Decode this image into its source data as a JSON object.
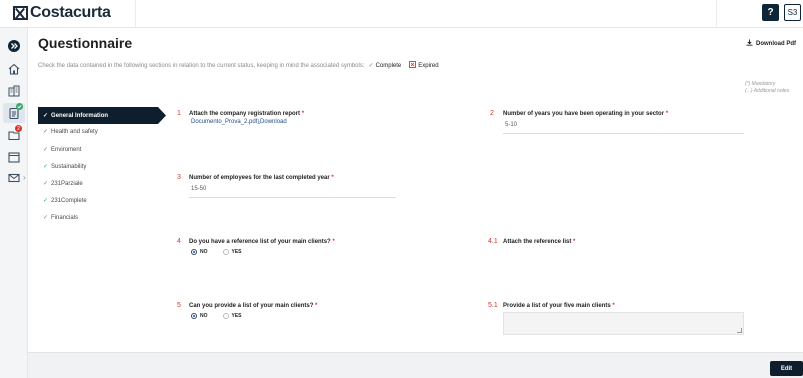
{
  "app": {
    "logo_text": "Costacurta"
  },
  "header": {
    "help_label": "?",
    "user_initials": "S3"
  },
  "rail": {
    "items": [
      {
        "icon": "expand-icon"
      },
      {
        "icon": "home-icon"
      },
      {
        "icon": "buildings-icon"
      },
      {
        "icon": "clipboard-icon",
        "badge_color": "#3aa86b"
      },
      {
        "icon": "folder-icon",
        "badge": "2",
        "badge_color": "#d9342b"
      },
      {
        "icon": "calendar-icon"
      },
      {
        "icon": "mail-icon"
      }
    ]
  },
  "page": {
    "title": "Questionnaire",
    "download_label": "Download Pdf",
    "subtitle": "Check the data contained in the following sections in relation to the current status, keeping in mind the associated symbols:",
    "status_complete": "Complete",
    "status_expired": "Expired",
    "legend_mandatory": "(*) Mandatory",
    "legend_notes": "(...) Additional notes"
  },
  "sections": [
    {
      "label": "General Information",
      "active": true
    },
    {
      "label": "Health and safety"
    },
    {
      "label": "Enviroment"
    },
    {
      "label": "Sustainability"
    },
    {
      "label": "231Parziale"
    },
    {
      "label": "231Complete"
    },
    {
      "label": "Financials"
    }
  ],
  "questions": {
    "q1": {
      "number": "1",
      "label": "Attach the company registration report",
      "file_name": "Documento_Prova_2.pdf",
      "download": "Download"
    },
    "q2": {
      "number": "2",
      "label": "Number of years you have been operating in your sector",
      "value": "5-10"
    },
    "q3": {
      "number": "3",
      "label": "Number of employees for the last completed year",
      "value": "15-50"
    },
    "q4": {
      "number": "4",
      "label": "Do you have a reference list of your main clients?",
      "option_no": "NO",
      "option_yes": "YES",
      "selected": "NO"
    },
    "q41": {
      "number": "4.1",
      "label": "Attach the reference list"
    },
    "q5": {
      "number": "5",
      "label": "Can you provide a list of your main clients?",
      "option_no": "NO",
      "option_yes": "YES",
      "selected": "NO"
    },
    "q51": {
      "number": "5.1",
      "label": "Provide a list of your five main clients",
      "value": ""
    }
  },
  "required_marker": "*",
  "footer": {
    "edit_label": "Edit"
  },
  "colors": {
    "accent": "#0e1e2c",
    "required": "#d9342b",
    "complete": "#3aa86b"
  }
}
